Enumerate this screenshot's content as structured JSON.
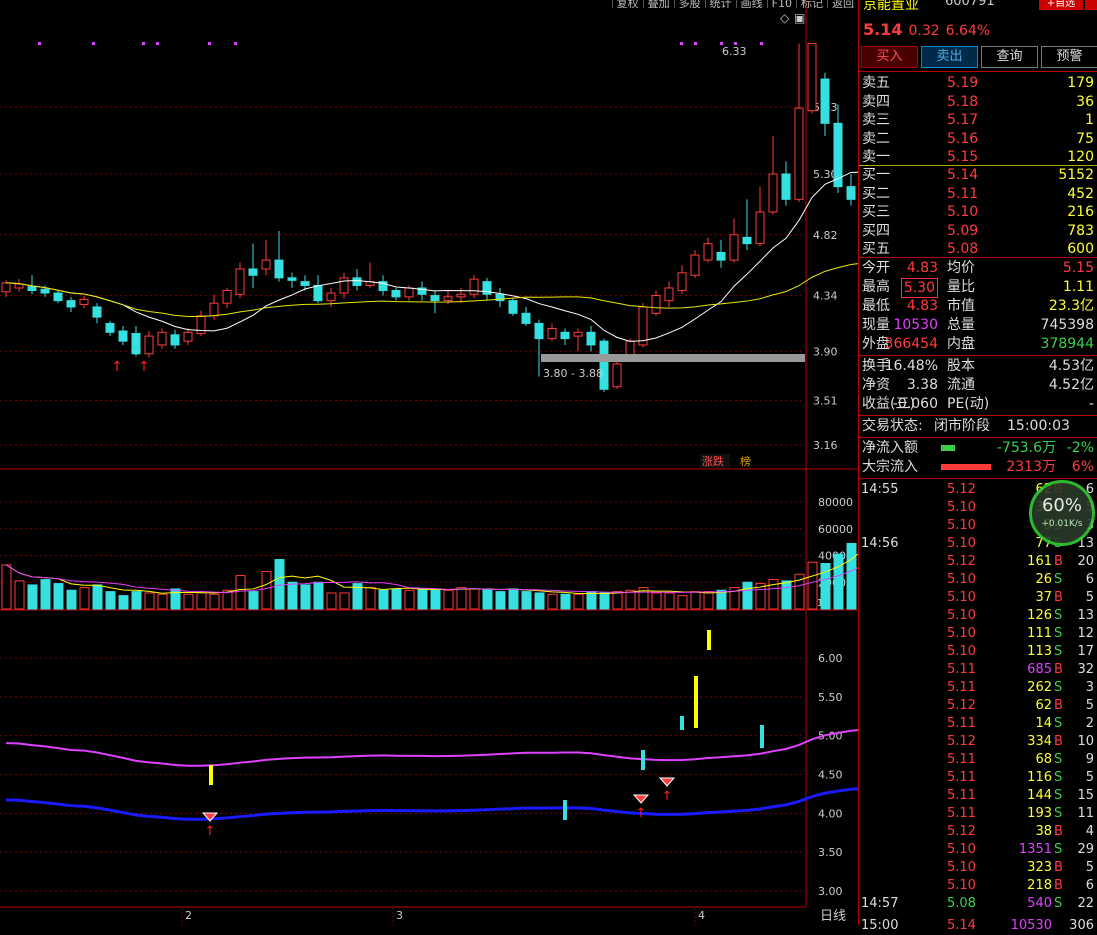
{
  "toolbar": {
    "buttons": [
      "复权",
      "叠加",
      "多股",
      "统计",
      "画线",
      "F10",
      "标记",
      "返回"
    ]
  },
  "chart": {
    "period_label": "日线",
    "axis_prices": [
      "5.83",
      "5.30",
      "4.82",
      "4.34",
      "3.90",
      "3.51",
      "3.16"
    ],
    "axis_volume": [
      "80000",
      "60000",
      "40000",
      "20000"
    ],
    "axis_volume_unit": "X10",
    "axis_indicator": [
      "6.00",
      "5.50",
      "5.00",
      "4.50",
      "4.00",
      "3.50",
      "3.00"
    ],
    "month_labels": [
      "2",
      "3",
      "4"
    ],
    "high_label": "6.33",
    "range_label": "3.80 - 3.88",
    "zhangdie": "涨跌",
    "bang": "榜"
  },
  "stock": {
    "name": "京能置业",
    "code": "600791",
    "fav": "+自选",
    "price": "5.14",
    "change": "0.32",
    "pct": "6.64%"
  },
  "trade_buttons": [
    "买入",
    "卖出",
    "查询",
    "预警"
  ],
  "asks": [
    {
      "label": "卖五",
      "price": "5.19",
      "vol": "179"
    },
    {
      "label": "卖四",
      "price": "5.18",
      "vol": "36"
    },
    {
      "label": "卖三",
      "price": "5.17",
      "vol": "1"
    },
    {
      "label": "卖二",
      "price": "5.16",
      "vol": "75"
    },
    {
      "label": "卖一",
      "price": "5.15",
      "vol": "120"
    }
  ],
  "bids": [
    {
      "label": "买一",
      "price": "5.14",
      "vol": "5152"
    },
    {
      "label": "买二",
      "price": "5.11",
      "vol": "452"
    },
    {
      "label": "买三",
      "price": "5.10",
      "vol": "216"
    },
    {
      "label": "买四",
      "price": "5.09",
      "vol": "783"
    },
    {
      "label": "买五",
      "price": "5.08",
      "vol": "600"
    }
  ],
  "stats": [
    {
      "l1": "今开",
      "v1": "4.83",
      "l2": "均价",
      "v2": "5.15"
    },
    {
      "l1": "最高",
      "v1": "5.30",
      "l2": "量比",
      "v2": "1.11"
    },
    {
      "l1": "最低",
      "v1": "4.83",
      "l2": "市值",
      "v2": "23.3亿"
    },
    {
      "l1": "现量",
      "v1": "10530",
      "l2": "总量",
      "v2": "745398"
    },
    {
      "l1": "外盘",
      "v1": "366454",
      "l2": "内盘",
      "v2": "378944"
    }
  ],
  "stats2": [
    {
      "l1": "换手",
      "v1": "16.48%",
      "l2": "股本",
      "v2": "4.53亿"
    },
    {
      "l1": "净资",
      "v1": "3.38",
      "l2": "流通",
      "v2": "4.52亿"
    },
    {
      "l1": "收益(三)",
      "v1": "-0.060",
      "l2": "PE(动)",
      "v2": "-"
    }
  ],
  "status": {
    "label": "交易状态:",
    "value": "闭市阶段",
    "time": "15:00:03"
  },
  "flow": [
    {
      "label": "净流入额",
      "value": "-753.6万",
      "pct": "-2%",
      "color": "#3cd04a"
    },
    {
      "label": "大宗流入",
      "value": "2313万",
      "pct": "6%",
      "color": "#ff3b3b"
    }
  ],
  "gauge": {
    "pct": "60%",
    "speed": "+0.01K/s"
  },
  "ticks": [
    {
      "t": "14:55",
      "p": "5.12",
      "v": "62",
      "d": "B",
      "n": "6"
    },
    {
      "t": "",
      "p": "5.10",
      "v": "31",
      "d": "S",
      "n": "5"
    },
    {
      "t": "",
      "p": "5.10",
      "v": "3",
      "d": "S",
      "n": "3"
    },
    {
      "t": "14:56",
      "p": "5.10",
      "v": "77",
      "d": "S",
      "n": "13"
    },
    {
      "t": "",
      "p": "5.12",
      "v": "161",
      "d": "B",
      "n": "20"
    },
    {
      "t": "",
      "p": "5.10",
      "v": "26",
      "d": "S",
      "n": "6"
    },
    {
      "t": "",
      "p": "5.10",
      "v": "37",
      "d": "B",
      "n": "5"
    },
    {
      "t": "",
      "p": "5.10",
      "v": "126",
      "d": "S",
      "n": "13"
    },
    {
      "t": "",
      "p": "5.10",
      "v": "111",
      "d": "S",
      "n": "12"
    },
    {
      "t": "",
      "p": "5.10",
      "v": "113",
      "d": "S",
      "n": "17"
    },
    {
      "t": "",
      "p": "5.11",
      "v": "685",
      "d": "B",
      "n": "32"
    },
    {
      "t": "",
      "p": "5.11",
      "v": "262",
      "d": "S",
      "n": "3"
    },
    {
      "t": "",
      "p": "5.12",
      "v": "62",
      "d": "B",
      "n": "5"
    },
    {
      "t": "",
      "p": "5.11",
      "v": "14",
      "d": "S",
      "n": "2"
    },
    {
      "t": "",
      "p": "5.12",
      "v": "334",
      "d": "B",
      "n": "10"
    },
    {
      "t": "",
      "p": "5.11",
      "v": "68",
      "d": "S",
      "n": "9"
    },
    {
      "t": "",
      "p": "5.11",
      "v": "116",
      "d": "S",
      "n": "5"
    },
    {
      "t": "",
      "p": "5.11",
      "v": "144",
      "d": "S",
      "n": "15"
    },
    {
      "t": "",
      "p": "5.11",
      "v": "193",
      "d": "S",
      "n": "11"
    },
    {
      "t": "",
      "p": "5.12",
      "v": "38",
      "d": "B",
      "n": "4"
    },
    {
      "t": "",
      "p": "5.10",
      "v": "1351",
      "d": "S",
      "n": "29"
    },
    {
      "t": "",
      "p": "5.10",
      "v": "323",
      "d": "B",
      "n": "5"
    },
    {
      "t": "",
      "p": "5.10",
      "v": "218",
      "d": "B",
      "n": "6"
    },
    {
      "t": "14:57",
      "p": "5.08",
      "v": "540",
      "d": "S",
      "n": "22"
    },
    {
      "t": "15:00",
      "p": "5.14",
      "v": "10530",
      "d": "",
      "n": "306"
    }
  ],
  "kline": {
    "candles": [
      [
        4.37,
        4.44,
        4.33,
        4.46
      ],
      [
        4.4,
        4.43,
        4.37,
        4.47
      ],
      [
        4.41,
        4.38,
        4.35,
        4.5
      ],
      [
        4.39,
        4.36,
        4.33,
        4.42
      ],
      [
        4.36,
        4.3,
        4.28,
        4.38
      ],
      [
        4.3,
        4.25,
        4.21,
        4.33
      ],
      [
        4.27,
        4.31,
        4.24,
        4.34
      ],
      [
        4.25,
        4.17,
        4.12,
        4.28
      ],
      [
        4.12,
        4.05,
        4.02,
        4.14
      ],
      [
        4.06,
        3.98,
        3.95,
        4.1
      ],
      [
        4.04,
        3.88,
        3.86,
        4.1
      ],
      [
        3.88,
        4.02,
        3.85,
        4.06
      ],
      [
        3.95,
        4.05,
        3.92,
        4.08
      ],
      [
        4.03,
        3.95,
        3.92,
        4.07
      ],
      [
        3.98,
        4.05,
        3.95,
        4.08
      ],
      [
        4.04,
        4.18,
        4.02,
        4.22
      ],
      [
        4.18,
        4.28,
        4.15,
        4.35
      ],
      [
        4.28,
        4.38,
        4.24,
        4.4
      ],
      [
        4.35,
        4.55,
        4.32,
        4.6
      ],
      [
        4.55,
        4.5,
        4.4,
        4.75
      ],
      [
        4.55,
        4.62,
        4.5,
        4.78
      ],
      [
        4.62,
        4.48,
        4.45,
        4.85
      ],
      [
        4.48,
        4.46,
        4.4,
        4.52
      ],
      [
        4.45,
        4.42,
        4.38,
        4.5
      ],
      [
        4.42,
        4.3,
        4.28,
        4.5
      ],
      [
        4.3,
        4.36,
        4.25,
        4.4
      ],
      [
        4.36,
        4.48,
        4.32,
        4.52
      ],
      [
        4.48,
        4.42,
        4.38,
        4.55
      ],
      [
        4.42,
        4.45,
        4.4,
        4.6
      ],
      [
        4.45,
        4.38,
        4.34,
        4.5
      ],
      [
        4.38,
        4.33,
        4.3,
        4.4
      ],
      [
        4.33,
        4.4,
        4.3,
        4.42
      ],
      [
        4.4,
        4.35,
        4.3,
        4.45
      ],
      [
        4.34,
        4.3,
        4.2,
        4.38
      ],
      [
        4.3,
        4.33,
        4.27,
        4.38
      ],
      [
        4.33,
        4.35,
        4.28,
        4.4
      ],
      [
        4.35,
        4.47,
        4.32,
        4.5
      ],
      [
        4.45,
        4.35,
        4.3,
        4.48
      ],
      [
        4.35,
        4.3,
        4.25,
        4.4
      ],
      [
        4.3,
        4.2,
        4.18,
        4.32
      ],
      [
        4.2,
        4.12,
        4.1,
        4.25
      ],
      [
        4.12,
        4.0,
        3.7,
        4.15
      ],
      [
        4.0,
        4.08,
        3.98,
        4.12
      ],
      [
        4.05,
        4.0,
        3.95,
        4.08
      ],
      [
        4.02,
        4.05,
        3.9,
        4.08
      ],
      [
        4.05,
        3.95,
        3.9,
        4.1
      ],
      [
        3.98,
        3.6,
        3.58,
        4.0
      ],
      [
        3.62,
        3.8,
        3.6,
        3.85
      ],
      [
        3.86,
        3.98,
        3.84,
        4.0
      ],
      [
        3.95,
        4.25,
        3.93,
        4.28
      ],
      [
        4.2,
        4.34,
        4.18,
        4.38
      ],
      [
        4.3,
        4.4,
        4.25,
        4.45
      ],
      [
        4.38,
        4.52,
        4.35,
        4.58
      ],
      [
        4.5,
        4.66,
        4.48,
        4.7
      ],
      [
        4.62,
        4.75,
        4.6,
        4.8
      ],
      [
        4.68,
        4.62,
        4.56,
        4.78
      ],
      [
        4.62,
        4.82,
        4.6,
        4.95
      ],
      [
        4.8,
        4.75,
        4.7,
        5.1
      ],
      [
        4.75,
        5.0,
        4.73,
        5.2
      ],
      [
        5.0,
        5.3,
        4.98,
        5.6
      ],
      [
        5.3,
        5.1,
        5.05,
        5.4
      ],
      [
        5.1,
        5.82,
        5.08,
        6.33
      ],
      [
        5.8,
        6.33,
        5.78,
        6.33
      ],
      [
        6.05,
        5.7,
        5.6,
        6.1
      ],
      [
        5.7,
        5.2,
        5.15,
        5.85
      ],
      [
        5.2,
        5.1,
        5.05,
        5.3
      ],
      [
        5.25,
        4.85,
        4.82,
        5.3
      ],
      [
        4.83,
        5.14,
        4.83,
        5.3
      ]
    ],
    "volume": [
      33,
      21,
      18,
      22,
      19,
      14,
      16,
      18,
      13,
      10,
      13,
      12,
      11,
      15,
      11,
      12,
      11,
      14,
      25,
      13,
      28,
      37,
      20,
      18,
      20,
      12,
      12,
      19,
      16,
      14,
      15,
      14,
      15,
      15,
      14,
      16,
      15,
      15,
      13,
      15,
      13,
      12,
      11,
      11,
      11,
      13,
      12,
      13,
      14,
      16,
      12,
      12,
      10,
      13,
      13,
      14,
      16,
      20,
      19,
      22,
      21,
      26,
      35,
      34,
      41,
      49,
      64,
      63,
      90,
      81,
      86
    ]
  }
}
